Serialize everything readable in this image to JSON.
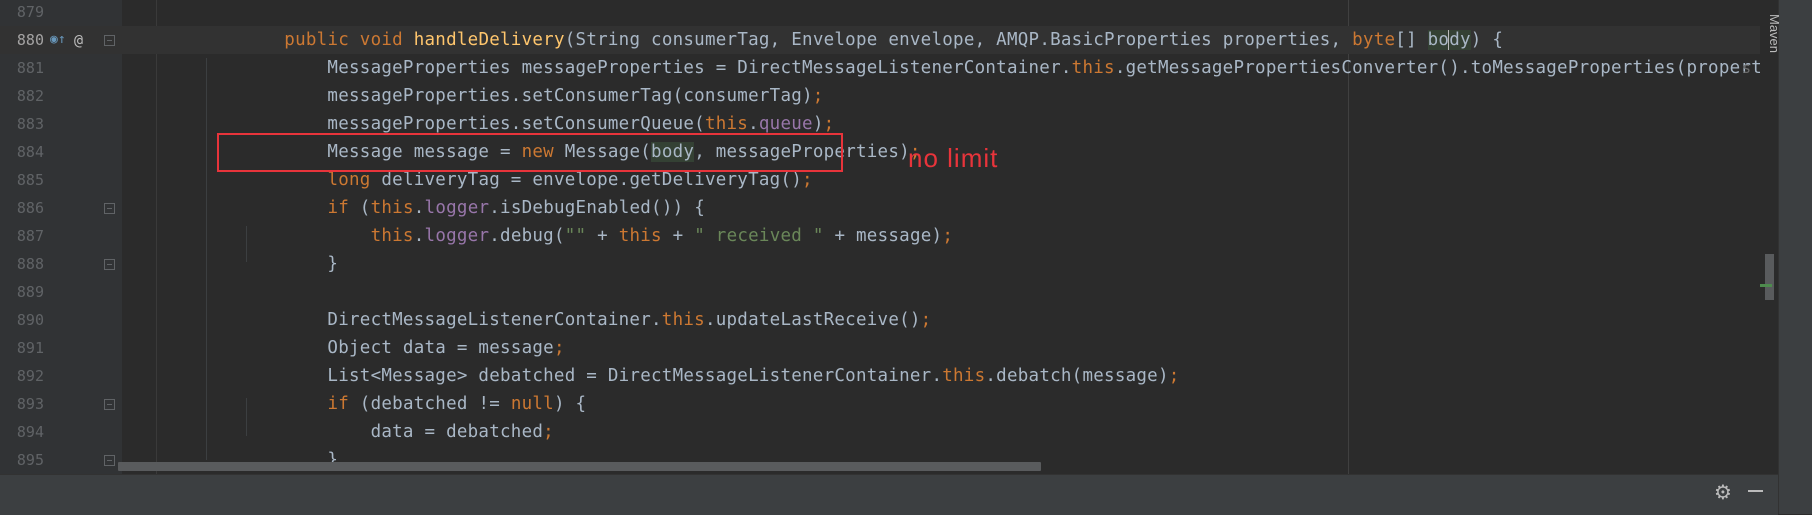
{
  "editor": {
    "lines": [
      {
        "num": "879",
        "segments": []
      },
      {
        "num": "880",
        "segments": [
          {
            "t": "        ",
            "c": ""
          },
          {
            "t": "public void ",
            "c": "kw"
          },
          {
            "t": "handleDelivery",
            "c": "fn"
          },
          {
            "t": "(String consumerTag, Envelope envelope, AMQP.BasicProperties properties, ",
            "c": ""
          },
          {
            "t": "byte",
            "c": "kw"
          },
          {
            "t": "[] ",
            "c": ""
          },
          {
            "t": "bo",
            "c": "hl"
          },
          {
            "t": "|",
            "c": "caret"
          },
          {
            "t": "dy",
            "c": "hl"
          },
          {
            "t": ") {",
            "c": ""
          }
        ]
      },
      {
        "num": "881",
        "segments": [
          {
            "t": "            MessageProperties messageProperties = DirectMessageListenerContainer.",
            "c": ""
          },
          {
            "t": "this",
            "c": "kw"
          },
          {
            "t": ".getMessagePropertiesConverter().toMessageProperties(properties, envelope,  ",
            "c": ""
          }
        ]
      },
      {
        "num": "882",
        "segments": [
          {
            "t": "            messageProperties.setConsumerTag(consumerTag)",
            "c": ""
          },
          {
            "t": ";",
            "c": "kw"
          }
        ]
      },
      {
        "num": "883",
        "segments": [
          {
            "t": "            messageProperties.setConsumerQueue(",
            "c": ""
          },
          {
            "t": "this",
            "c": "kw"
          },
          {
            "t": ".",
            "c": ""
          },
          {
            "t": "queue",
            "c": "fld"
          },
          {
            "t": ")",
            "c": ""
          },
          {
            "t": ";",
            "c": "kw"
          }
        ]
      },
      {
        "num": "884",
        "segments": [
          {
            "t": "            Message message = ",
            "c": ""
          },
          {
            "t": "new ",
            "c": "kw"
          },
          {
            "t": "Message(",
            "c": ""
          },
          {
            "t": "body",
            "c": "hl"
          },
          {
            "t": ", messageProperties)",
            "c": ""
          },
          {
            "t": ";",
            "c": "kw"
          }
        ]
      },
      {
        "num": "885",
        "segments": [
          {
            "t": "            ",
            "c": ""
          },
          {
            "t": "long ",
            "c": "kw"
          },
          {
            "t": "deliveryTag = envelope.getDeliveryTag()",
            "c": ""
          },
          {
            "t": ";",
            "c": "kw"
          }
        ]
      },
      {
        "num": "886",
        "segments": [
          {
            "t": "            ",
            "c": ""
          },
          {
            "t": "if ",
            "c": "kw"
          },
          {
            "t": "(",
            "c": ""
          },
          {
            "t": "this",
            "c": "kw"
          },
          {
            "t": ".",
            "c": ""
          },
          {
            "t": "logger",
            "c": "fld"
          },
          {
            "t": ".isDebugEnabled()) {",
            "c": ""
          }
        ]
      },
      {
        "num": "887",
        "segments": [
          {
            "t": "                ",
            "c": ""
          },
          {
            "t": "this",
            "c": "kw"
          },
          {
            "t": ".",
            "c": ""
          },
          {
            "t": "logger",
            "c": "fld"
          },
          {
            "t": ".debug(",
            "c": ""
          },
          {
            "t": "\"\"",
            "c": "str"
          },
          {
            "t": " + ",
            "c": ""
          },
          {
            "t": "this",
            "c": "kw"
          },
          {
            "t": " + ",
            "c": ""
          },
          {
            "t": "\" received \"",
            "c": "str"
          },
          {
            "t": " + message)",
            "c": ""
          },
          {
            "t": ";",
            "c": "kw"
          }
        ]
      },
      {
        "num": "888",
        "segments": [
          {
            "t": "            }",
            "c": ""
          }
        ]
      },
      {
        "num": "889",
        "segments": []
      },
      {
        "num": "890",
        "segments": [
          {
            "t": "            DirectMessageListenerContainer.",
            "c": ""
          },
          {
            "t": "this",
            "c": "kw"
          },
          {
            "t": ".updateLastReceive()",
            "c": ""
          },
          {
            "t": ";",
            "c": "kw"
          }
        ]
      },
      {
        "num": "891",
        "segments": [
          {
            "t": "            Object data = message",
            "c": ""
          },
          {
            "t": ";",
            "c": "kw"
          }
        ]
      },
      {
        "num": "892",
        "segments": [
          {
            "t": "            List<Message> debatched = DirectMessageListenerContainer.",
            "c": ""
          },
          {
            "t": "this",
            "c": "kw"
          },
          {
            "t": ".debatch(message)",
            "c": ""
          },
          {
            "t": ";",
            "c": "kw"
          }
        ]
      },
      {
        "num": "893",
        "segments": [
          {
            "t": "            ",
            "c": ""
          },
          {
            "t": "if ",
            "c": "kw"
          },
          {
            "t": "(debatched != ",
            "c": ""
          },
          {
            "t": "null",
            "c": "kw"
          },
          {
            "t": ") {",
            "c": ""
          }
        ]
      },
      {
        "num": "894",
        "segments": [
          {
            "t": "                data = debatched",
            "c": ""
          },
          {
            "t": ";",
            "c": "kw"
          }
        ]
      },
      {
        "num": "895",
        "segments": [
          {
            "t": "            }",
            "c": ""
          }
        ]
      }
    ],
    "current_line": "880",
    "truncated_edge_glyph": "s"
  },
  "annotation": {
    "text": "no  limit",
    "color": "#e8343b"
  },
  "side_panel": {
    "maven_label": "Maven"
  },
  "gutter_icons": {
    "line_880": [
      "implements-method-icon",
      "override-annotation-icon"
    ]
  }
}
